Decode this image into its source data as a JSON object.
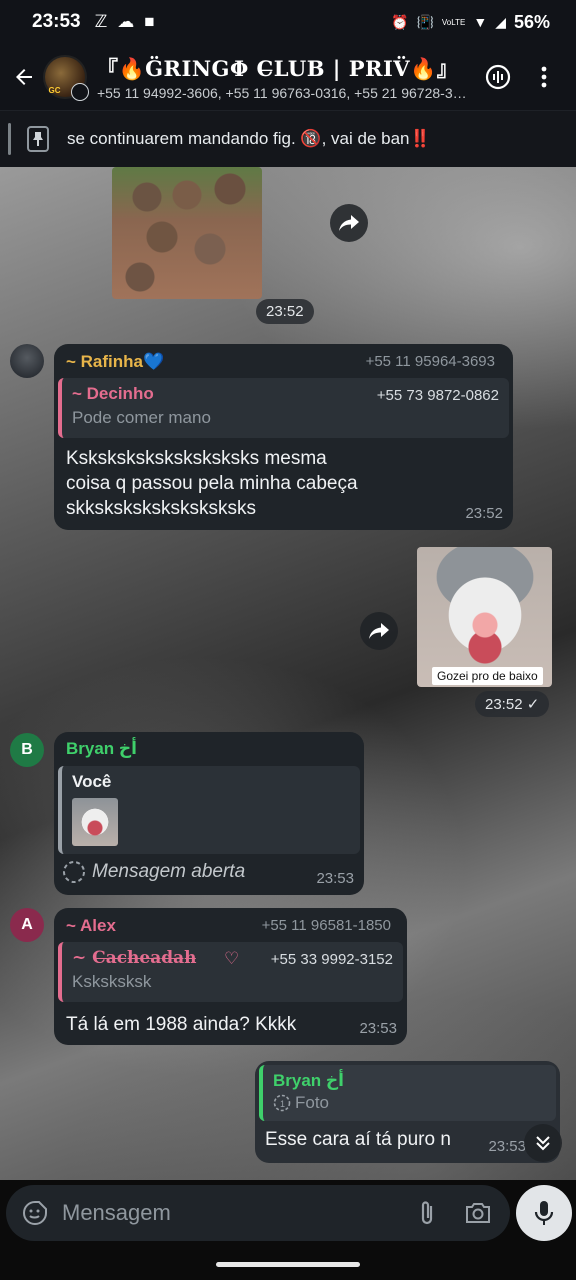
{
  "status": {
    "time": "23:53",
    "battery": "56%",
    "network": "VoLTE"
  },
  "header": {
    "title": "『🔥G̈RINGΦ C̶LUB | PRIV̈🔥』",
    "participants": "+55 11 94992-3606, +55 11 96763-0316, +55 21 96728-3…"
  },
  "pinned": {
    "text": "se continuarem mandando fig. 🔞, vai de ban‼️"
  },
  "messages": {
    "m1": {
      "time": "23:52"
    },
    "m2": {
      "sender": "~ Rafinha💙",
      "phone": "+55 11 95964-3693",
      "reply_name": "~ Decinho",
      "reply_phone": "+55 73 9872-0862",
      "reply_text": "Pode comer mano",
      "text_line1": "Ksksksksksksksksksks mesma",
      "text_line2": "coisa q passou pela minha cabeça",
      "text_line3": "skksksksksksksksksks",
      "time": "23:52"
    },
    "m3": {
      "caption": "Gozei pro de baixo",
      "time": "23:52"
    },
    "m4": {
      "avatar_letter": "B",
      "sender": "Bryan أخ",
      "reply_name": "Você",
      "status_text": "Mensagem aberta",
      "time": "23:53"
    },
    "m5": {
      "avatar_letter": "A",
      "sender": "~ Alex",
      "phone": "+55 11 96581-1850",
      "reply_name": "~ C̶a̶c̶h̶e̶a̶d̶a̶h̶",
      "reply_heart": "♡",
      "reply_phone": "+55 33 9992-3152",
      "reply_text": "Ksksksksk",
      "text": "Tá lá em 1988 ainda? Kkkk",
      "time": "23:53"
    },
    "m6": {
      "reply_name": "Bryan أخ",
      "reply_text": "Foto",
      "text": "Esse cara aí tá puro n",
      "time": "23:53"
    }
  },
  "input": {
    "placeholder": "Mensagem"
  },
  "colors": {
    "accent_green": "#3fd06b",
    "rafinha_name": "#e8b54a",
    "reply_pink": "#e46d8f",
    "bryan_name": "#3fd06b",
    "alex_name": "#e46d8f",
    "bubble": "#1f2429"
  }
}
